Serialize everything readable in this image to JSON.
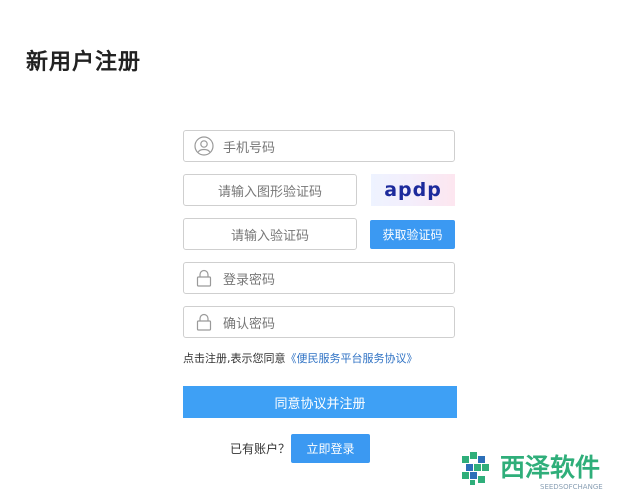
{
  "page": {
    "title": "新用户注册"
  },
  "form": {
    "phone_placeholder": "手机号码",
    "image_captcha_placeholder": "请输入图形验证码",
    "captcha_text": "apdp",
    "sms_code_placeholder": "请输入验证码",
    "get_code_label": "获取验证码",
    "password_placeholder": "登录密码",
    "confirm_password_placeholder": "确认密码",
    "agreement_prefix": "点击注册,表示您同意",
    "agreement_link": "《便民服务平台服务协议》",
    "register_label": "同意协议并注册",
    "has_account_text": "已有账户？",
    "login_label": "立即登录"
  },
  "watermark": {
    "brand_cn": "西泽软件",
    "brand_en": "SEEDSOFCHANGE"
  },
  "colors": {
    "primary": "#3b99f2",
    "link": "#2f72c4",
    "watermark_green": "#2fae7a",
    "watermark_blue": "#2c6fb8"
  },
  "icons": {
    "phone": "user-circle-icon",
    "password": "lock-icon",
    "confirm": "lock-icon"
  }
}
